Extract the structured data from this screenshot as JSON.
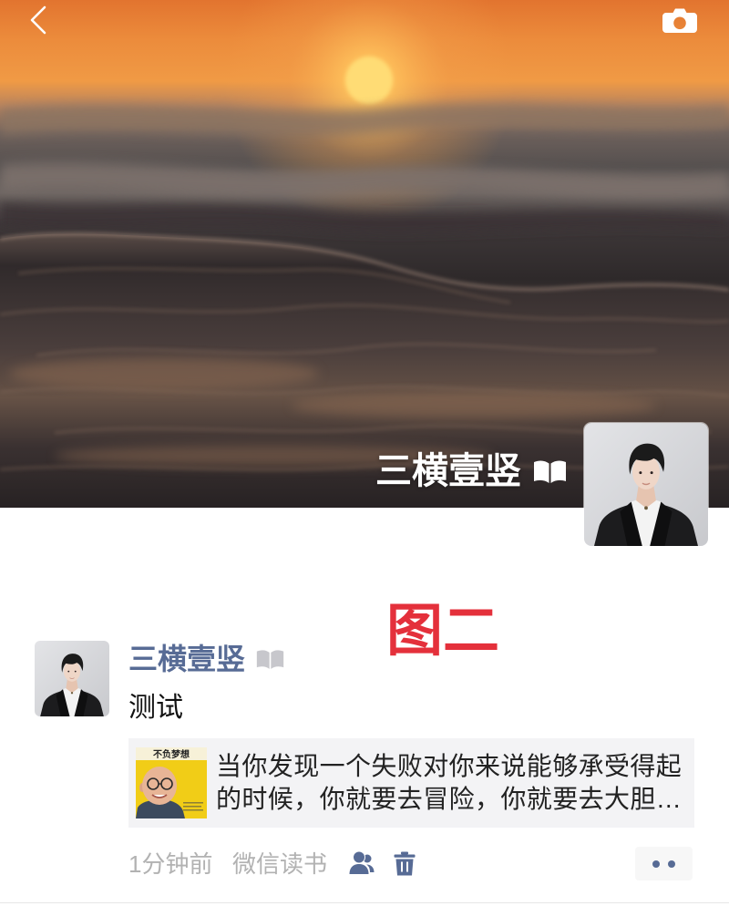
{
  "header": {
    "back_icon": "chevron-left-icon",
    "camera_icon": "camera-icon"
  },
  "cover": {
    "username": "三横壹竖",
    "badge_icon": "book-icon"
  },
  "annotation": {
    "text": "图二"
  },
  "post": {
    "author": "三横壹竖",
    "author_badge_icon": "book-icon",
    "text": "测试",
    "link_card": {
      "cover_text": "不负梦想",
      "title": "当你发现一个失败对你来说能够承受得起的时候，你就要去冒险，你就要去大胆…"
    },
    "time": "1分钟前",
    "source": "微信读书",
    "privacy_icon": "person-icon",
    "delete_icon": "trash-icon",
    "more_icon": "more-dots-icon"
  },
  "colors": {
    "link_blue": "#576b95",
    "annotation_red": "#e4303b",
    "meta_gray": "#b2b2b2",
    "card_bg": "#f3f3f5"
  }
}
